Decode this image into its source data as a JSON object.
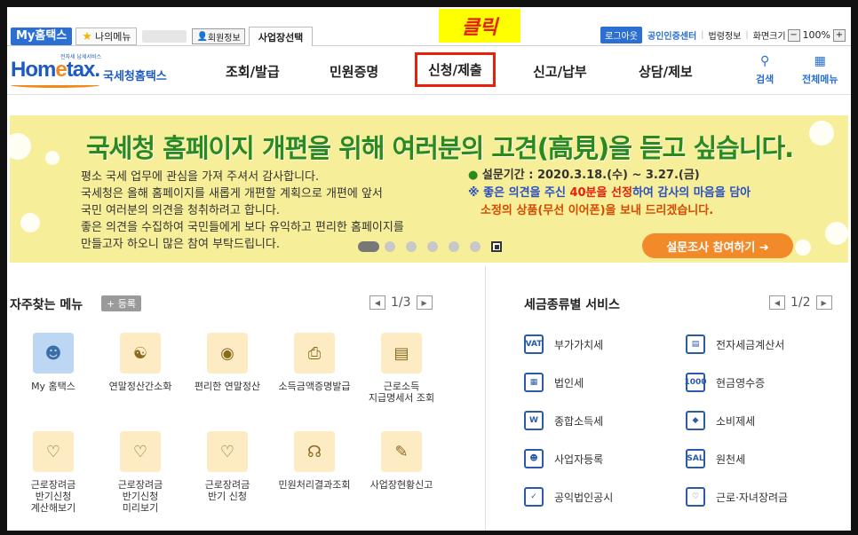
{
  "util": {
    "my_hometax": "My홈택스",
    "my_menu": "나의메뉴",
    "member_info": "회원정보",
    "biz_select": "사업장선택",
    "logout": "로그아웃",
    "cert_center": "공인인증센터",
    "law_info": "법령정보",
    "screen_size": "화면크기",
    "zoom": "100%"
  },
  "annotation": {
    "click": "클릭"
  },
  "nav": {
    "logo_word_a": "Hom",
    "logo_word_e": "e",
    "logo_word_b": "tax.",
    "logo_small": "전자세 납세서비스",
    "logo_sub": "국세청홈택스",
    "items": [
      "조회/발급",
      "민원증명",
      "신청/제출",
      "신고/납부",
      "상담/제보"
    ],
    "search": "검색",
    "all_menu": "전체메뉴"
  },
  "banner": {
    "title": "국세청 홈페이지 개편을 위해 여러분의 고견(高見)을 듣고 싶습니다.",
    "body": [
      "평소 국세 업무에 관심을 가져 주셔서 감사합니다.",
      "국세청은 올해 홈페이지를 새롭게 개편할 계획으로 개편에 앞서",
      "국민 여러분의 의견을 청취하려고 합니다.",
      "좋은 의견을 수집하여 국민들에게 보다 유익하고 편리한 홈페이지를",
      "만들고자 하오니 많은 참여 부탁드립니다."
    ],
    "period_label": "설문기간 : 2020.3.18.(수) ~ 3.27.(금)",
    "note_a": "※ 좋은 의견을 주신 ",
    "note_red": "40분을 선정",
    "note_b": "하여 감사의 마음을 담아",
    "note_c": "소정의 상품(무선 이어폰)을 보내 드리겠습니다.",
    "cta": "설문조사 참여하기 ➔"
  },
  "favorites": {
    "title": "자주찾는 메뉴",
    "register": "+ 등록",
    "page": "1/3",
    "items": [
      "My 홈택스",
      "연말정산간소화",
      "편리한 연말정산",
      "소득금액증명발급",
      "근로소득\n지급명세서 조회",
      "근로장려금\n반기신청\n계산해보기",
      "근로장려금\n반기신청\n미리보기",
      "근로장려금\n반기 신청",
      "민원처리결과조회",
      "사업장현황신고"
    ]
  },
  "tax_service": {
    "title": "세금종류별 서비스",
    "page": "1/2",
    "items": [
      "부가가치세",
      "전자세금계산서",
      "법인세",
      "현금영수증",
      "종합소득세",
      "소비제세",
      "사업자등록",
      "원천세",
      "공익법인공시",
      "근로·자녀장려금"
    ]
  }
}
